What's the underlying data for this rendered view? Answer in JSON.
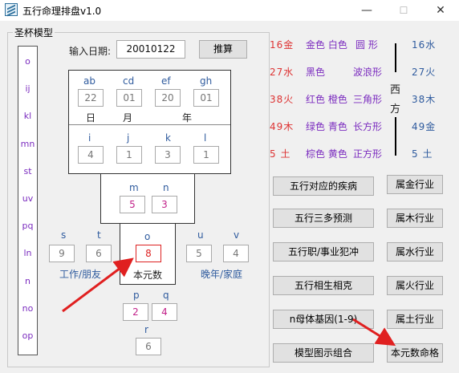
{
  "window": {
    "title": "五行命理排盘v1.0",
    "minimize": "—",
    "maximize": "☐",
    "close": "✕"
  },
  "group": {
    "title": "圣杯模型"
  },
  "vertical_list": [
    "o",
    "ij",
    "kl",
    "mn",
    "st",
    "uv",
    "pq",
    "ln",
    "n",
    "no",
    "op"
  ],
  "date": {
    "label": "输入日期:",
    "value": "20010122",
    "button": "推算"
  },
  "grid": {
    "headers": [
      "ab",
      "cd",
      "ef",
      "gh"
    ],
    "values": [
      "22",
      "01",
      "20",
      "01"
    ],
    "units": [
      "日",
      "月",
      "年"
    ],
    "headers2": [
      "i",
      "j",
      "k",
      "l"
    ],
    "values2": [
      "4",
      "1",
      "3",
      "1"
    ]
  },
  "mn": {
    "m_label": "m",
    "n_label": "n",
    "m_value": "5",
    "n_value": "3"
  },
  "st": {
    "s_label": "s",
    "t_label": "t",
    "s_value": "9",
    "t_value": "6",
    "caption": "工作/朋友"
  },
  "center": {
    "o_label": "o",
    "o_value": "8",
    "caption": "本元数"
  },
  "uv": {
    "u_label": "u",
    "v_label": "v",
    "u_value": "5",
    "v_value": "4",
    "caption": "晚年/家庭"
  },
  "pq": {
    "p_label": "p",
    "q_label": "q",
    "p_value": "2",
    "q_value": "4"
  },
  "r": {
    "label": "r",
    "value": "6"
  },
  "legend": {
    "rows": [
      {
        "num": "16金",
        "colors": "金色 白色",
        "shape": "圆 形",
        "right": "16水"
      },
      {
        "num": "27水",
        "colors": "黑色",
        "shape": "波浪形",
        "right": "27火"
      },
      {
        "num": "38火",
        "colors": "红色 橙色",
        "shape": "三角形",
        "right": "38木"
      },
      {
        "num": "49木",
        "colors": "绿色 青色",
        "shape": "长方形",
        "right": "49金"
      },
      {
        "num": "5 土",
        "colors": "棕色 黄色",
        "shape": "正方形",
        "right": "5 土"
      }
    ],
    "west_1": "西",
    "west_2": "方"
  },
  "buttons": {
    "left": [
      "五行对应的疾病",
      "五行三多预测",
      "五行职/事业犯冲",
      "五行相生相克",
      "n母体基因(1-9)",
      "模型图示组合"
    ],
    "right": [
      "属金行业",
      "属木行业",
      "属水行业",
      "属火行业",
      "属土行业",
      "本元数命格"
    ]
  },
  "colors": {
    "red": "#d33333",
    "blue": "#2f5b9e",
    "purple": "#7b2cbf",
    "arrow": "#e02020"
  }
}
